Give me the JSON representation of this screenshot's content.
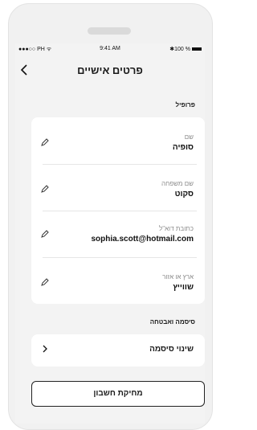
{
  "status_bar": {
    "carrier": "●●●○○ PH ᯤ",
    "time": "9:41 AM",
    "battery": "✱100 %"
  },
  "header": {
    "title": "פרטים אישיים",
    "back_icon": "chevron-left-icon"
  },
  "profile": {
    "section_label": "פרופיל",
    "fields": [
      {
        "label": "שם",
        "value": "סופיה"
      },
      {
        "label": "שם משפחה",
        "value": "סקוט"
      },
      {
        "label": "כתובת דוא\"ל",
        "value": "sophia.scott@hotmail.com"
      },
      {
        "label": "ארץ או אזור",
        "value": "שווייץ"
      }
    ]
  },
  "security": {
    "section_label": "סיסמה ואבטחה",
    "change_password": "שינוי סיסמה"
  },
  "delete_account": "מחיקת חשבון"
}
